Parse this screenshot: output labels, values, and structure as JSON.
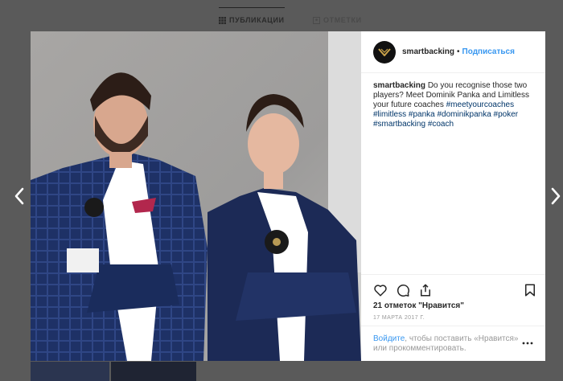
{
  "profile_tabs": {
    "posts_label": "ПУБЛИКАЦИИ",
    "tagged_label": "ОТМЕТКИ"
  },
  "post": {
    "username": "smartbacking",
    "separator": "•",
    "follow_label": "Подписаться",
    "caption": {
      "username": "smartbacking",
      "text": "Do you recognise those two players? Meet Dominik Panka and Limitless your future coaches",
      "hashtags": [
        "#meetyourcoaches",
        "#limitless",
        "#panka",
        "#dominikpanka",
        "#poker",
        "#smartbacking",
        "#coach"
      ]
    },
    "likes_count": "21 отметок",
    "likes_label": "\"Нравится\"",
    "date": "17 МАРТА 2017 Г.",
    "login_link": "Войдите",
    "login_text": ", чтобы поставить «Нравится» или прокомментировать."
  },
  "icons": {
    "prev": "chevron-left-icon",
    "next": "chevron-right-icon",
    "like": "heart-icon",
    "comment": "comment-icon",
    "share": "share-icon",
    "save": "bookmark-icon",
    "more": "more-dots-icon"
  },
  "colors": {
    "link": "#3897f0",
    "hashtag": "#003569",
    "overlay": "#5a5a5a"
  }
}
